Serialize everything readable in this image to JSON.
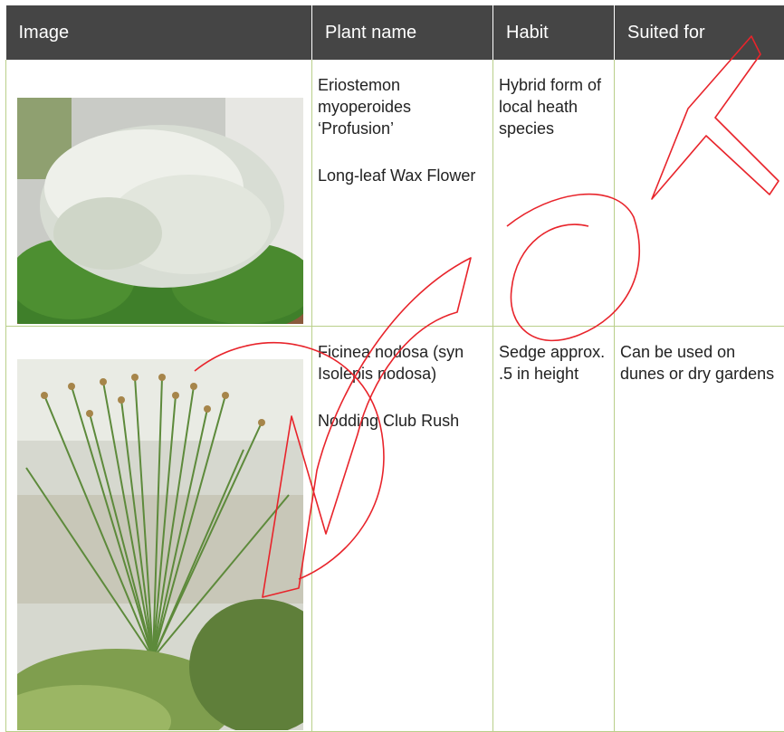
{
  "table": {
    "headers": [
      "Image",
      "Plant name",
      "Habit",
      "Suited for"
    ],
    "rows": [
      {
        "image_alt": "white flowering shrub photo",
        "botanical_name": "Eriostemon myoperoides ‘Profusion’",
        "common_name": "Long-leaf Wax Flower",
        "habit": "Hybrid form of local heath species",
        "suited_for": ""
      },
      {
        "image_alt": "rush grass photo",
        "botanical_name": "Ficinea nodosa (syn Isolepis nodosa)",
        "common_name": "Nodding Club Rush",
        "habit": "Sedge approx. .5 in height",
        "suited_for": "Can be used on dunes or dry gardens"
      }
    ]
  },
  "colors": {
    "header_bg": "#454545",
    "grid_line": "#b9cf8a",
    "watermark": "#e8242b"
  }
}
